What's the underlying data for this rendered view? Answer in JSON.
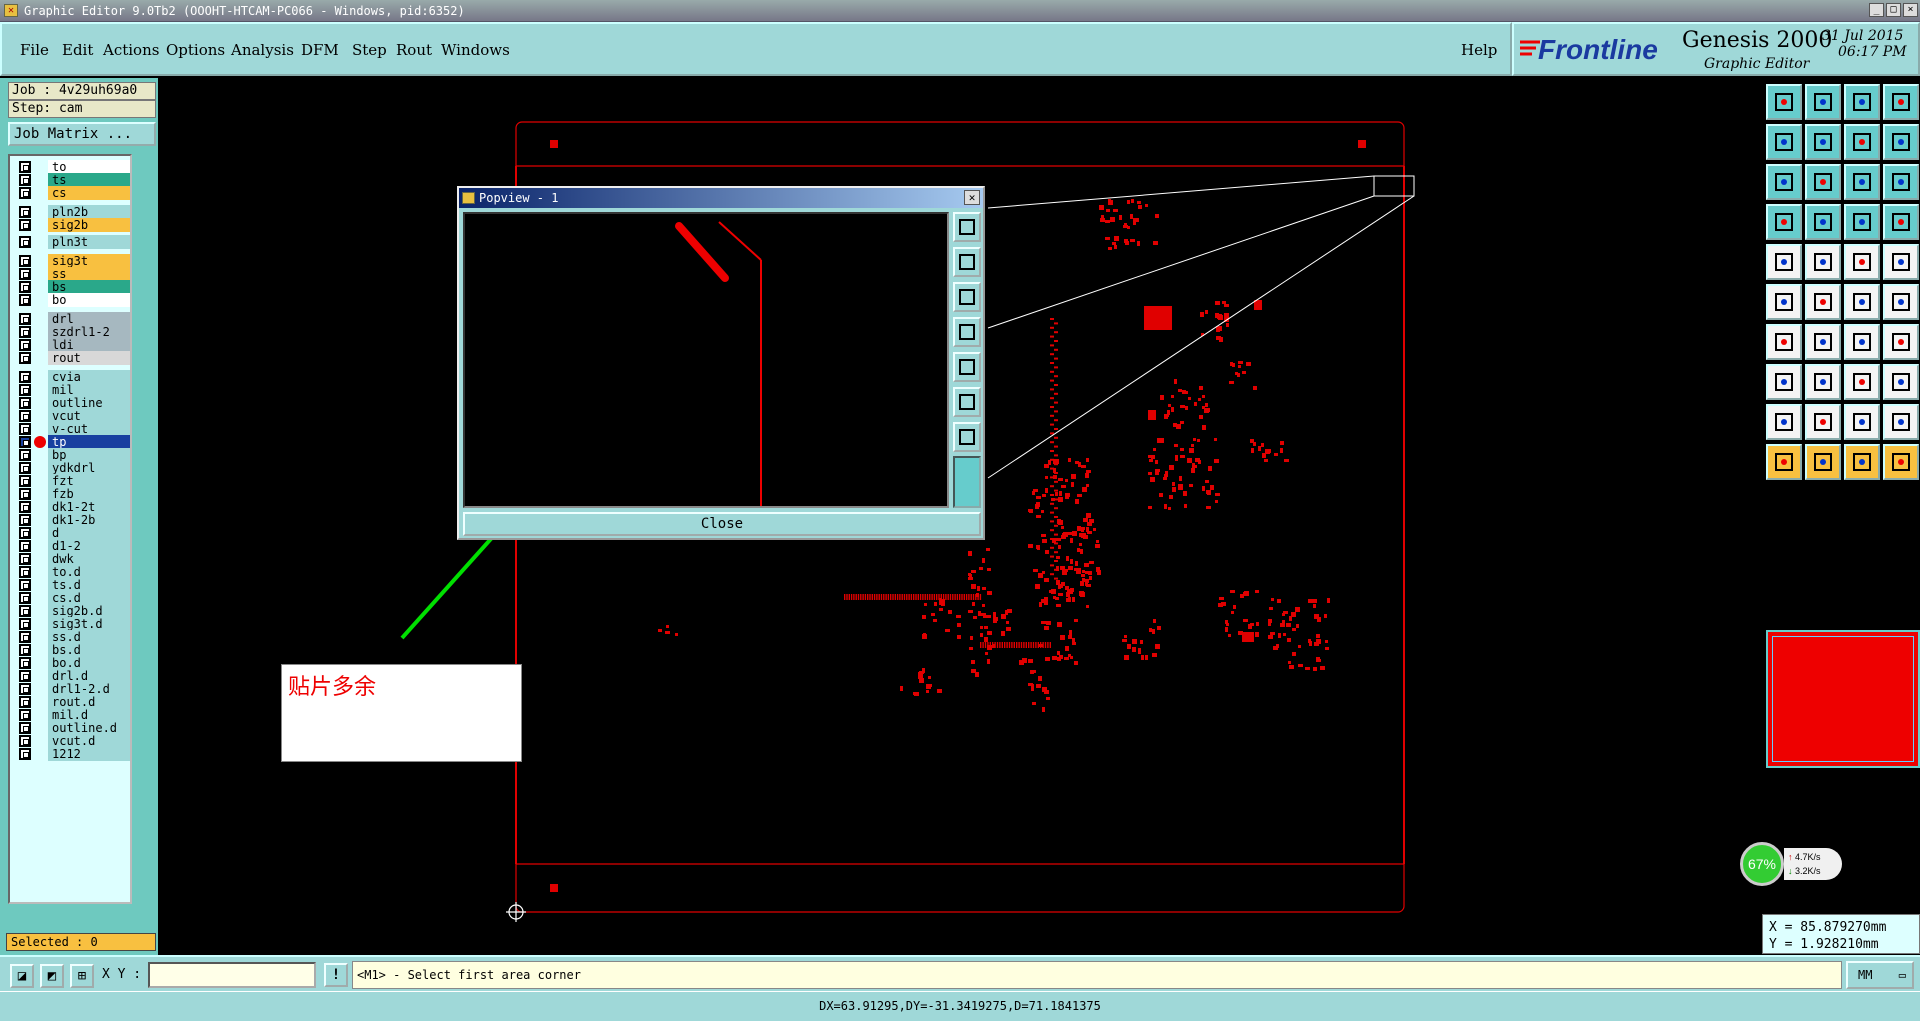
{
  "window": {
    "title": "Graphic Editor 9.0Tb2 (OOOHT-HTCAM-PC066 - Windows, pid:6352)",
    "buttons": [
      "_",
      "□",
      "×"
    ]
  },
  "menu": [
    "File",
    "Edit",
    "Actions",
    "Options",
    "Analysis",
    "DFM",
    "Step",
    "Rout",
    "Windows"
  ],
  "help": "Help",
  "brand": {
    "logo": "Frontline",
    "product": "Genesis 2000",
    "subtitle": "Graphic Editor",
    "date": "31 Jul 2015",
    "time": "06:17 PM"
  },
  "job": {
    "job_label": "Job : 4v29uh69a0",
    "step_label": "Step: cam",
    "matrix_button": "Job Matrix ..."
  },
  "layers": [
    {
      "name": "to",
      "color": "#ffffff"
    },
    {
      "name": "ts",
      "color": "#2aa88a"
    },
    {
      "name": "cs",
      "color": "#f8c040"
    },
    {
      "name": "pln2b",
      "color": "#9fd8d8"
    },
    {
      "name": "sig2b",
      "color": "#f8c040"
    },
    {
      "name": "pln3t",
      "color": "#9fd8d8"
    },
    {
      "name": "sig3t",
      "color": "#f8c040"
    },
    {
      "name": "ss",
      "color": "#f8c040"
    },
    {
      "name": "bs",
      "color": "#2aa88a"
    },
    {
      "name": "bo",
      "color": "#ffffff"
    },
    {
      "name": "drl",
      "color": "#a6b8c0"
    },
    {
      "name": "szdrl1-2",
      "color": "#a6b8c0"
    },
    {
      "name": "ldi",
      "color": "#a6b8c0"
    },
    {
      "name": "rout",
      "color": "#d8d8d8"
    },
    {
      "name": "cvia",
      "color": "#9fd8d8"
    },
    {
      "name": "mil",
      "color": "#9fd8d8"
    },
    {
      "name": "outline",
      "color": "#9fd8d8"
    },
    {
      "name": "vcut",
      "color": "#9fd8d8"
    },
    {
      "name": "v-cut",
      "color": "#9fd8d8"
    },
    {
      "name": "tp",
      "color": "#1840a0",
      "active": true
    },
    {
      "name": "bp",
      "color": "#9fd8d8"
    },
    {
      "name": "ydkdrl",
      "color": "#9fd8d8"
    },
    {
      "name": "fzt",
      "color": "#9fd8d8"
    },
    {
      "name": "fzb",
      "color": "#9fd8d8"
    },
    {
      "name": "dk1-2t",
      "color": "#9fd8d8"
    },
    {
      "name": "dk1-2b",
      "color": "#9fd8d8"
    },
    {
      "name": "d",
      "color": "#9fd8d8"
    },
    {
      "name": "d1-2",
      "color": "#9fd8d8"
    },
    {
      "name": "dwk",
      "color": "#9fd8d8"
    },
    {
      "name": "to.d",
      "color": "#9fd8d8"
    },
    {
      "name": "ts.d",
      "color": "#9fd8d8"
    },
    {
      "name": "cs.d",
      "color": "#9fd8d8"
    },
    {
      "name": "sig2b.d",
      "color": "#9fd8d8"
    },
    {
      "name": "sig3t.d",
      "color": "#9fd8d8"
    },
    {
      "name": "ss.d",
      "color": "#9fd8d8"
    },
    {
      "name": "bs.d",
      "color": "#9fd8d8"
    },
    {
      "name": "bo.d",
      "color": "#9fd8d8"
    },
    {
      "name": "drl.d",
      "color": "#9fd8d8"
    },
    {
      "name": "drl1-2.d",
      "color": "#9fd8d8"
    },
    {
      "name": "rout.d",
      "color": "#9fd8d8"
    },
    {
      "name": "mil.d",
      "color": "#9fd8d8"
    },
    {
      "name": "outline.d",
      "color": "#9fd8d8"
    },
    {
      "name": "vcut.d",
      "color": "#9fd8d8"
    },
    {
      "name": "1212",
      "color": "#9fd8d8"
    }
  ],
  "selected": "Selected : 0",
  "popview": {
    "title": "Popview - 1",
    "close": "Close"
  },
  "annotation": "贴片多余",
  "network": {
    "percent": "67%",
    "up": "4.7K/s",
    "down": "3.2K/s"
  },
  "coords": {
    "x": "X = 85.879270mm",
    "y": "Y = 1.928210mm"
  },
  "command": {
    "xy_label": "X Y :",
    "xy_value": "",
    "prompt": "<M1> - Select first area corner",
    "units": "MM"
  },
  "status": "DX=63.91295,DY=-31.3419275,D=71.1841375",
  "colors": {
    "panel": "#9fd8d8",
    "toolbar": "#66cccc",
    "board": "#e00000"
  }
}
